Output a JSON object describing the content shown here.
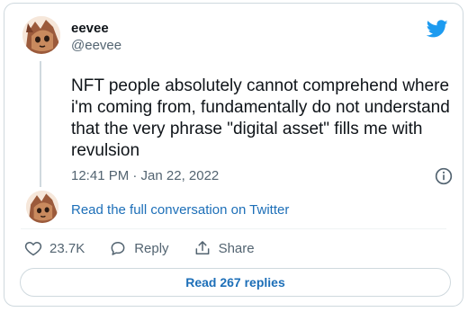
{
  "tweet": {
    "display_name": "eevee",
    "handle": "@eevee",
    "text": "NFT people absolutely cannot comprehend where i'm coming from, fundamentally do not understand that the very phrase \"digital asset\" fills me with revulsion",
    "timestamp": "12:41 PM · Jan 22, 2022"
  },
  "conversation_link": "Read the full conversation on Twitter",
  "actions": {
    "likes": "23.7K",
    "reply": "Reply",
    "share": "Share"
  },
  "read_replies": "Read 267 replies",
  "icons": {
    "brand": "twitter-bird-icon",
    "info": "info-icon",
    "like": "heart-icon",
    "reply": "reply-icon",
    "share": "share-icon"
  },
  "colors": {
    "twitter_blue": "#1d9bf0",
    "link_blue": "#1d6fb8",
    "muted": "#536471",
    "border": "#cfd9de"
  }
}
